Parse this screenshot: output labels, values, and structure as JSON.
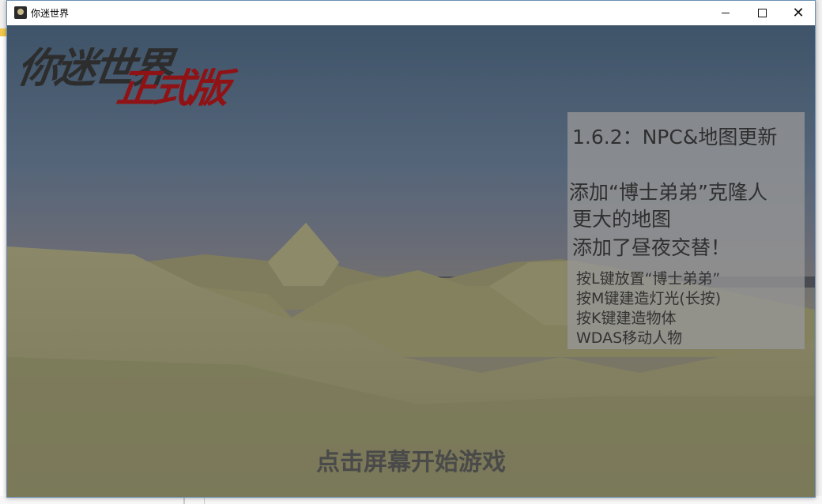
{
  "window": {
    "title": "你迷世界",
    "buttons": {
      "minimize": "minimize",
      "maximize": "maximize",
      "close": "close"
    }
  },
  "game": {
    "logo_main": "你迷世界",
    "logo_sub": "正式版",
    "panel": {
      "title": "1.6.2：NPC&地图更新",
      "lines": [
        "添加“博士弟弟”克隆人",
        "更大的地图",
        "添加了昼夜交替！"
      ],
      "controls": [
        "按L键放置“博士弟弟”",
        "按M键建造灯光(长按)",
        "按K键建造物体",
        "WDAS移动人物"
      ]
    },
    "start_prompt": "点击屏幕开始游戏"
  },
  "colors": {
    "sky_top": "#3f5469",
    "terrain": "#7d7b5c",
    "logo_sub": "#8f1215",
    "panel_bg": "#969696"
  },
  "icons": {
    "app": "game-app-icon"
  }
}
